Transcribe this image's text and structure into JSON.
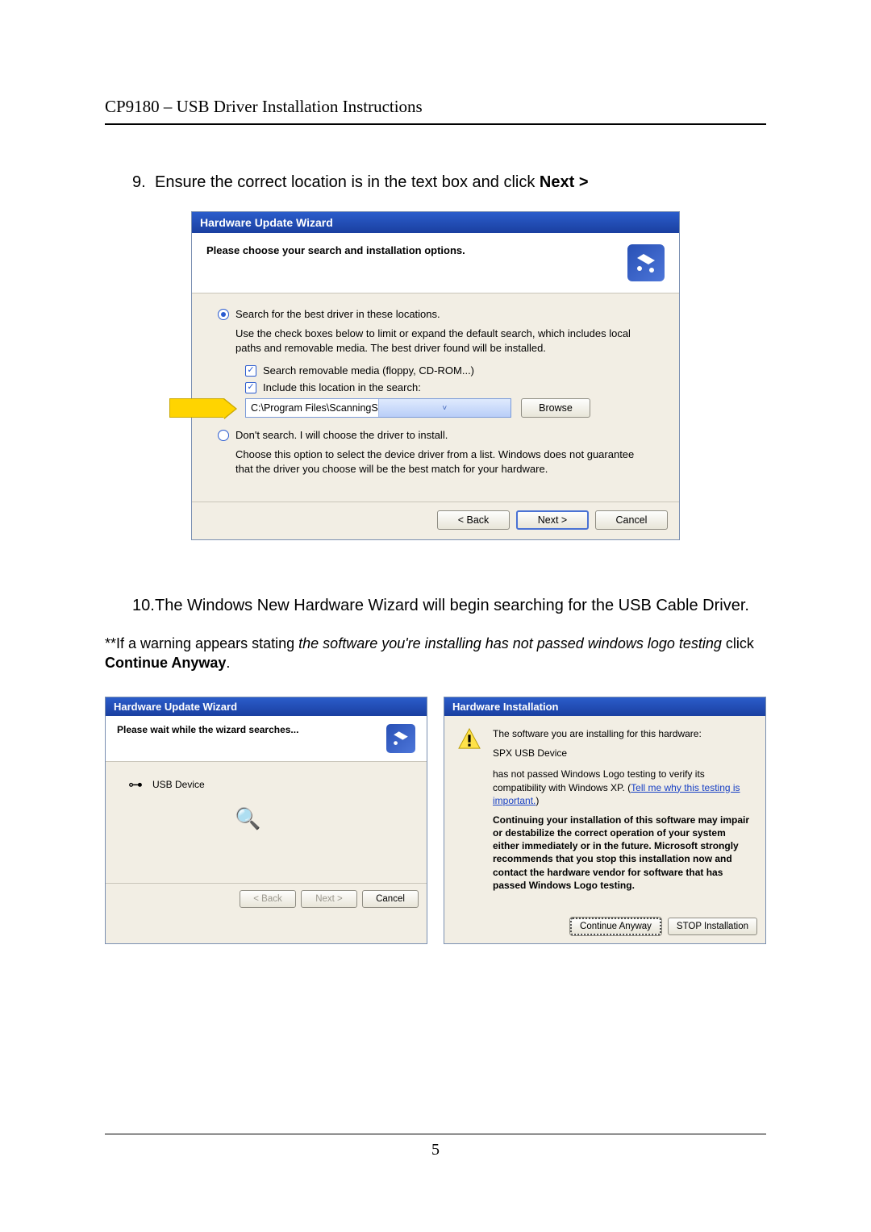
{
  "header": {
    "title": "CP9180 – USB Driver Installation Instructions"
  },
  "step9": {
    "num": "9.",
    "text_pre": "Ensure the correct location is in the text box and click ",
    "text_bold": "Next >"
  },
  "wiz": {
    "title": "Hardware Update Wizard",
    "head": "Please choose your search and installation options.",
    "opt1": "Search for the best driver in these locations.",
    "opt1_desc": "Use the check boxes below to limit or expand the default search, which includes local paths and removable media. The best driver found will be installed.",
    "chk_removable": "Search removable media (floppy, CD-ROM...)",
    "chk_include": "Include this location in the search:",
    "path": "C:\\Program Files\\ScanningSuite\\Actron\\Drivers",
    "browse": "Browse",
    "opt2": "Don't search. I will choose the driver to install.",
    "opt2_desc": "Choose this option to select the device driver from a list.  Windows does not guarantee that the driver you choose will be the best match for your hardware.",
    "back": "< Back",
    "next": "Next >",
    "cancel": "Cancel"
  },
  "step10": {
    "num": "10.",
    "text": "The Windows New Hardware Wizard will begin searching for the USB Cable Driver."
  },
  "note": {
    "pre": "**If a warning appears stating ",
    "italic": "the software you're installing has not passed windows logo testing",
    "post": " click ",
    "bold": "Continue Anyway",
    "end": "."
  },
  "searching": {
    "title": "Hardware Update Wizard",
    "head": "Please wait while the wizard searches...",
    "device": "USB Device",
    "back": "< Back",
    "next": "Next >",
    "cancel": "Cancel"
  },
  "warn": {
    "title": "Hardware Installation",
    "line1": "The software you are installing for this hardware:",
    "hw": "SPX USB Device",
    "line2a": "has not passed Windows Logo testing to verify its compatibility with Windows XP. (",
    "link": "Tell me why this testing is important.",
    "line2b": ")",
    "bold": "Continuing your installation of this software may impair or destabilize the correct operation of your system either immediately or in the future. Microsoft strongly recommends that you stop this installation now and contact the hardware vendor for software that has passed Windows Logo testing.",
    "continue": "Continue Anyway",
    "stop": "STOP Installation"
  },
  "footer": {
    "page": "5"
  }
}
